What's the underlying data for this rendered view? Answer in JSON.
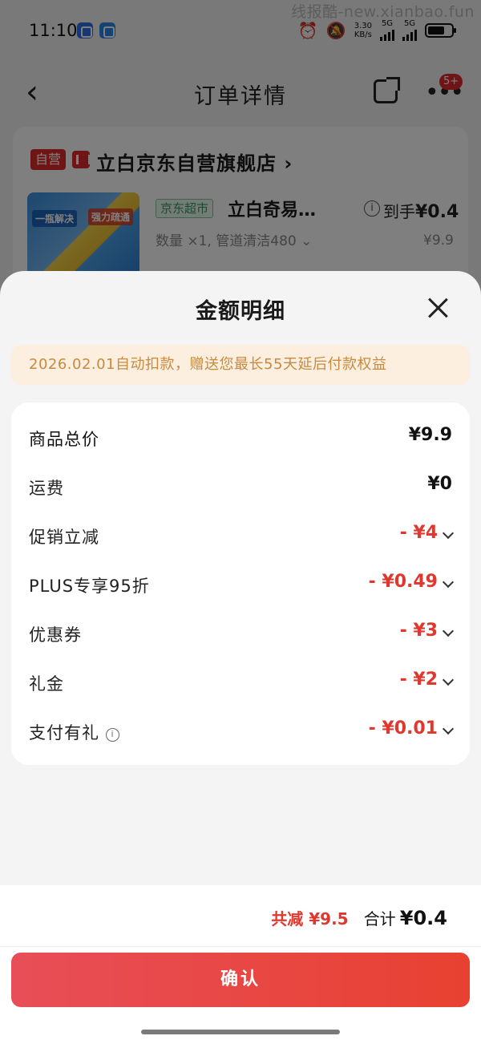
{
  "status_bar": {
    "time": "11:10",
    "net_speed": "3.30",
    "net_unit": "KB/s",
    "net_type_1": "5G",
    "net_type_2": "5G"
  },
  "watermark": "线报酷-new.xianbao.fun",
  "nav": {
    "back_symbol": "‹",
    "title": "订单详情",
    "badge": "5+"
  },
  "order": {
    "self_tag": "自营",
    "store_name": "立白京东自营旗舰店 ›",
    "image_text_1": "一瓶解决",
    "image_text_2": "强力疏通",
    "supermarket_tag": "京东超市",
    "product_name": "立白奇易…",
    "spec": "数量 ×1, 管道清洁480 ⌄",
    "arrive_label": "到手",
    "arrive_price": "¥0.4",
    "original_price": "¥9.9"
  },
  "sheet": {
    "title": "金额明细",
    "notice": "2026.02.01自动扣款，赠送您最长55天延后付款权益",
    "rows": [
      {
        "label": "商品总价",
        "value": "¥9.9"
      },
      {
        "label": "运费",
        "value": "¥0"
      },
      {
        "label": "促销立减",
        "value": "- ¥4"
      },
      {
        "label": "PLUS专享95折",
        "value": "- ¥0.49"
      },
      {
        "label": "优惠券",
        "value": "- ¥3"
      },
      {
        "label": "礼金",
        "value": "- ¥2"
      },
      {
        "label": "支付有礼",
        "value": "- ¥0.01"
      }
    ],
    "info_symbol": "i",
    "saved_text": "共减 ¥9.5",
    "total_label": "合计",
    "total_value": "¥0.4",
    "confirm_label": "确认"
  },
  "colors": {
    "accent_red": "#e0382f",
    "notice_text": "#c78a3e",
    "notice_bg": "#fcefe0"
  }
}
